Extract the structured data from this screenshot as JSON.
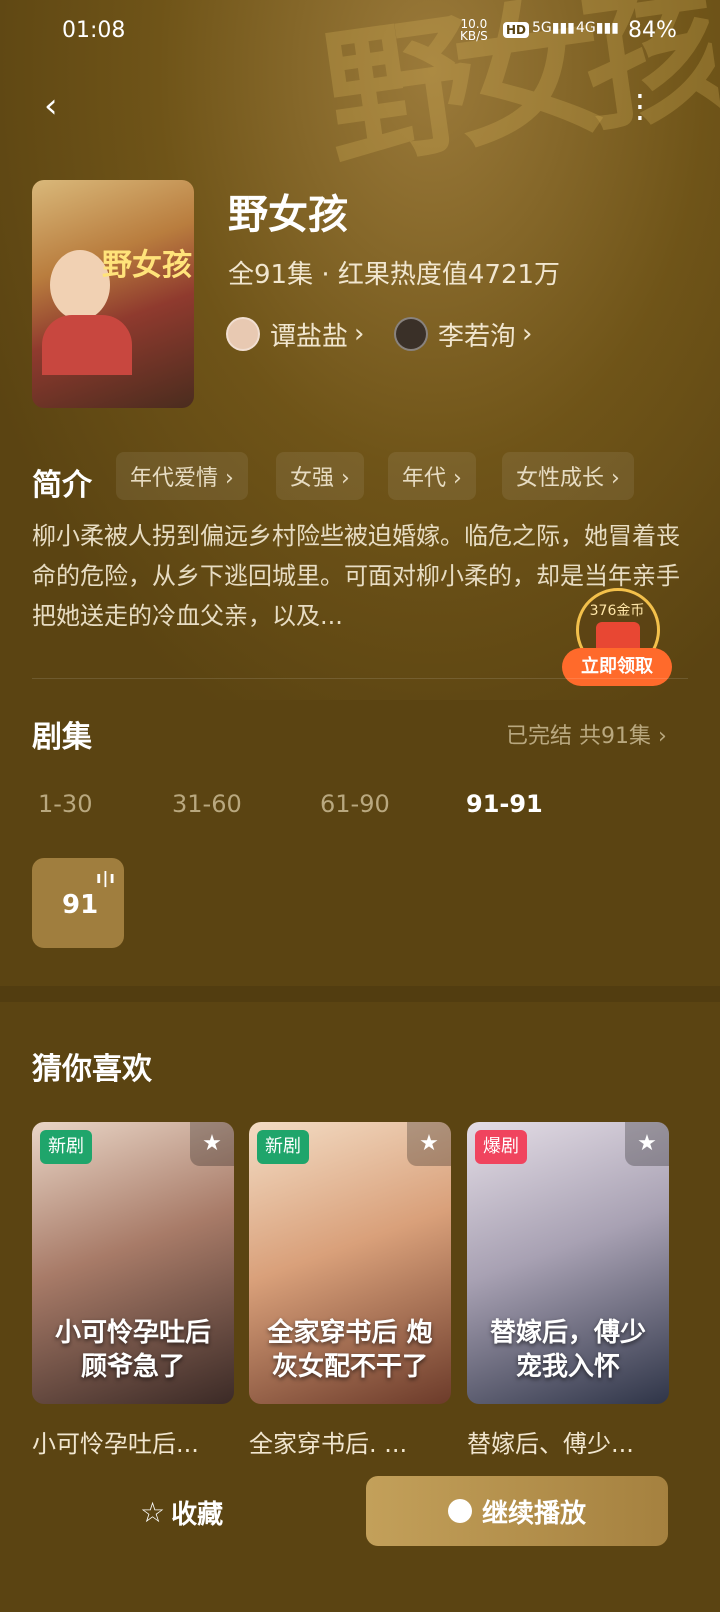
{
  "status_bar": {
    "time": "01:08",
    "net_rate_value": "10.0",
    "net_rate_unit": "KB/S",
    "hd": "HD",
    "signal1": "5G",
    "signal2": "4G",
    "battery": "84%"
  },
  "drama": {
    "title": "野女孩",
    "meta": "全91集 · 红果热度值4721万",
    "poster_title": "野女孩",
    "actors": [
      {
        "name": "谭盐盐",
        "arrow": "›"
      },
      {
        "name": "李若洵",
        "arrow": "›"
      }
    ]
  },
  "intro": {
    "label": "简介",
    "tags": [
      "年代爱情 ›",
      "女强 ›",
      "年代 ›",
      "女性成长 ›"
    ],
    "synopsis": "柳小柔被人拐到偏远乡村险些被迫婚嫁。临危之际，她冒着丧命的危险，从乡下逃回城里。可面对柳小柔的，却是当年亲手把她送走的冷血父亲，以及..."
  },
  "reward": {
    "amount": "376金币",
    "button": "立即领取"
  },
  "episodes": {
    "label": "剧集",
    "status": "已完结 共91集 ›",
    "ranges": [
      "1-30",
      "31-60",
      "61-90",
      "91-91"
    ],
    "active_range": 3,
    "tiles": [
      {
        "number": "91",
        "playing_icon": "ı|ı"
      }
    ]
  },
  "recommend": {
    "label": "猜你喜欢",
    "items": [
      {
        "badge": "新剧",
        "badge_color": "#1fa56b",
        "cover_caption": "小可怜孕吐后 顾爷急了",
        "title": "小可怜孕吐后..."
      },
      {
        "badge": "新剧",
        "badge_color": "#1fa56b",
        "cover_caption": "全家穿书后 炮灰女配不干了",
        "title": "全家穿书后. ..."
      },
      {
        "badge": "爆剧",
        "badge_color": "#f0445e",
        "cover_caption": "替嫁后，傅少宠我入怀",
        "title": "替嫁后、傅少..."
      }
    ]
  },
  "bottom": {
    "favorite": "收藏",
    "continue": "继续播放"
  },
  "colors": {
    "background": "#5b4412",
    "accent": "#a07e3e",
    "reward_orange": "#ff6a2b"
  }
}
